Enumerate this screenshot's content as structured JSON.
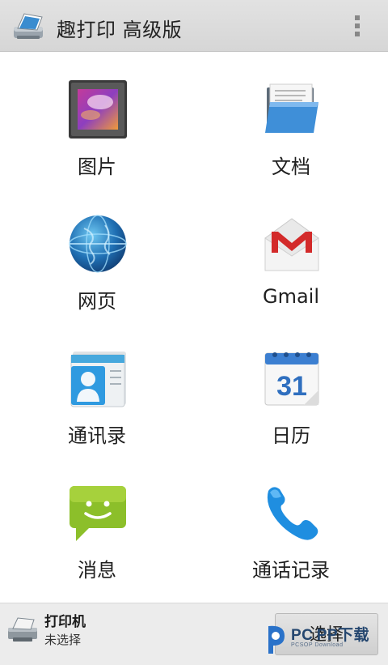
{
  "header": {
    "title": "趣打印 高级版",
    "app_icon": "printer-app-icon",
    "menu_icon": "overflow-menu-icon"
  },
  "grid": {
    "items": [
      {
        "label": "图片",
        "icon": "gallery-icon"
      },
      {
        "label": "文档",
        "icon": "folder-documents-icon"
      },
      {
        "label": "网页",
        "icon": "globe-icon"
      },
      {
        "label": "Gmail",
        "icon": "gmail-icon"
      },
      {
        "label": "通讯录",
        "icon": "contacts-icon"
      },
      {
        "label": "日历",
        "icon": "calendar-icon"
      },
      {
        "label": "消息",
        "icon": "messages-icon"
      },
      {
        "label": "通话记录",
        "icon": "call-log-icon"
      }
    ],
    "calendar_day": "31"
  },
  "printer": {
    "title": "打印机",
    "status": "未选择",
    "select_label": "选择",
    "icon": "printer-icon"
  },
  "watermark": {
    "brand": "PC PP下载",
    "sub": "PCSOP Download"
  }
}
